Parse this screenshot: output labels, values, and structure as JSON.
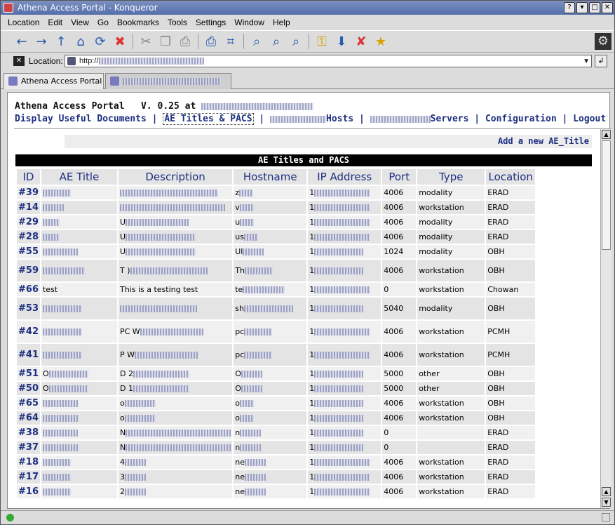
{
  "window": {
    "title": "Athena Access Portal - Konqueror",
    "buttons": [
      "?",
      "▾",
      "□",
      "✕"
    ]
  },
  "menu": [
    "Location",
    "Edit",
    "View",
    "Go",
    "Bookmarks",
    "Tools",
    "Settings",
    "Window",
    "Help"
  ],
  "toolbar": [
    {
      "icon": "back-icon",
      "glyph": "←"
    },
    {
      "icon": "forward-icon",
      "glyph": "→"
    },
    {
      "icon": "up-icon",
      "glyph": "↑"
    },
    {
      "icon": "home-icon",
      "glyph": "⌂"
    },
    {
      "icon": "reload-icon",
      "glyph": "⟳"
    },
    {
      "icon": "stop-icon",
      "glyph": "✖"
    },
    {
      "icon": "cut-icon",
      "glyph": "✂"
    },
    {
      "icon": "copy-icon",
      "glyph": "❐"
    },
    {
      "icon": "paste-icon",
      "glyph": "⎙"
    },
    {
      "icon": "print-icon",
      "glyph": "⎙"
    },
    {
      "icon": "print-preview-icon",
      "glyph": "⌗"
    },
    {
      "icon": "zoom-fit-icon",
      "glyph": "⌕"
    },
    {
      "icon": "zoom-in-icon",
      "glyph": "⌕"
    },
    {
      "icon": "zoom-out-icon",
      "glyph": "⌕"
    },
    {
      "icon": "security-lock-icon",
      "glyph": "⚿"
    },
    {
      "icon": "download-icon",
      "glyph": "⬇"
    },
    {
      "icon": "clear-icon",
      "glyph": "✘"
    },
    {
      "icon": "bookmark-new-icon",
      "glyph": "★"
    }
  ],
  "location": {
    "label": "Location:",
    "url": "http://",
    "go": "↲"
  },
  "tabs": [
    {
      "label": "Athena Access Portal"
    },
    {
      "label": ""
    }
  ],
  "page": {
    "app": "Athena Access Portal",
    "version": "V. 0.25 at",
    "nav": {
      "display": "Display Useful Documents",
      "ae": "AE Titles & PACS",
      "hosts": "Hosts",
      "servers": "Servers",
      "config": "Configuration",
      "logout": "Logout",
      "sep": "|"
    },
    "add": "Add a new AE_Title",
    "table_title": "AE Titles and PACS",
    "columns": [
      "ID",
      "AE Title",
      "Description",
      "Hostname",
      "IP Address",
      "Port",
      "Type",
      "Location"
    ],
    "rows": [
      {
        "id": "#39",
        "ae": "",
        "desc": "",
        "host": "z",
        "ip": "1",
        "port": "4006",
        "type": "modality",
        "loc": "ERAD"
      },
      {
        "id": "#14",
        "ae": "",
        "desc": "",
        "host": "v",
        "ip": "1",
        "port": "4006",
        "type": "workstation",
        "loc": "ERAD"
      },
      {
        "id": "#29",
        "ae": "",
        "desc": "U",
        "host": "u",
        "ip": "1",
        "port": "4006",
        "type": "modality",
        "loc": "ERAD"
      },
      {
        "id": "#28",
        "ae": "",
        "desc": "U",
        "host": "us",
        "ip": "1",
        "port": "4006",
        "type": "modality",
        "loc": "ERAD"
      },
      {
        "id": "#55",
        "ae": "",
        "desc": "U",
        "host": "Ul",
        "ip": "1",
        "port": "1024",
        "type": "modality",
        "loc": "OBH"
      },
      {
        "id": "#59",
        "ae": "",
        "desc": "T )",
        "host": "Th",
        "ip": "1",
        "port": "4006",
        "type": "workstation",
        "loc": "OBH",
        "tall": true
      },
      {
        "id": "#66",
        "ae": "test",
        "desc": "This is a testing test",
        "host": "te",
        "ip": "1",
        "port": "0",
        "type": "workstation",
        "loc": "Chowan"
      },
      {
        "id": "#53",
        "ae": "",
        "desc": "",
        "host": "sh",
        "ip": "1",
        "port": "5040",
        "type": "modality",
        "loc": "OBH",
        "tall": true
      },
      {
        "id": "#42",
        "ae": "",
        "desc": "PC W",
        "host": "pc",
        "ip": "1",
        "port": "4006",
        "type": "workstation",
        "loc": "PCMH",
        "tall": true
      },
      {
        "id": "#41",
        "ae": "",
        "desc": "P W",
        "host": "pc",
        "ip": "1",
        "port": "4006",
        "type": "workstation",
        "loc": "PCMH",
        "tall": true
      },
      {
        "id": "#51",
        "ae": "O",
        "desc": "D 2",
        "host": "O",
        "ip": "1",
        "port": "5000",
        "type": "other",
        "loc": "OBH"
      },
      {
        "id": "#50",
        "ae": "O",
        "desc": "D 1",
        "host": "O",
        "ip": "1",
        "port": "5000",
        "type": "other",
        "loc": "OBH"
      },
      {
        "id": "#65",
        "ae": "",
        "desc": "o",
        "host": "o",
        "ip": "1",
        "port": "4006",
        "type": "workstation",
        "loc": "OBH"
      },
      {
        "id": "#64",
        "ae": "",
        "desc": "o",
        "host": "o",
        "ip": "1",
        "port": "4006",
        "type": "workstation",
        "loc": "OBH"
      },
      {
        "id": "#38",
        "ae": "",
        "desc": "N",
        "host": "n",
        "ip": "1",
        "port": "0",
        "type": "",
        "loc": "ERAD"
      },
      {
        "id": "#37",
        "ae": "",
        "desc": "N",
        "host": "n",
        "ip": "1",
        "port": "0",
        "type": "",
        "loc": "ERAD"
      },
      {
        "id": "#18",
        "ae": "",
        "desc": "4",
        "host": "ne",
        "ip": "1",
        "port": "4006",
        "type": "workstation",
        "loc": "ERAD"
      },
      {
        "id": "#17",
        "ae": "",
        "desc": "3",
        "host": "ne",
        "ip": "1",
        "port": "4006",
        "type": "workstation",
        "loc": "ERAD"
      },
      {
        "id": "#16",
        "ae": "",
        "desc": "2",
        "host": "ne",
        "ip": "1",
        "port": "4006",
        "type": "workstation",
        "loc": "ERAD"
      }
    ]
  }
}
